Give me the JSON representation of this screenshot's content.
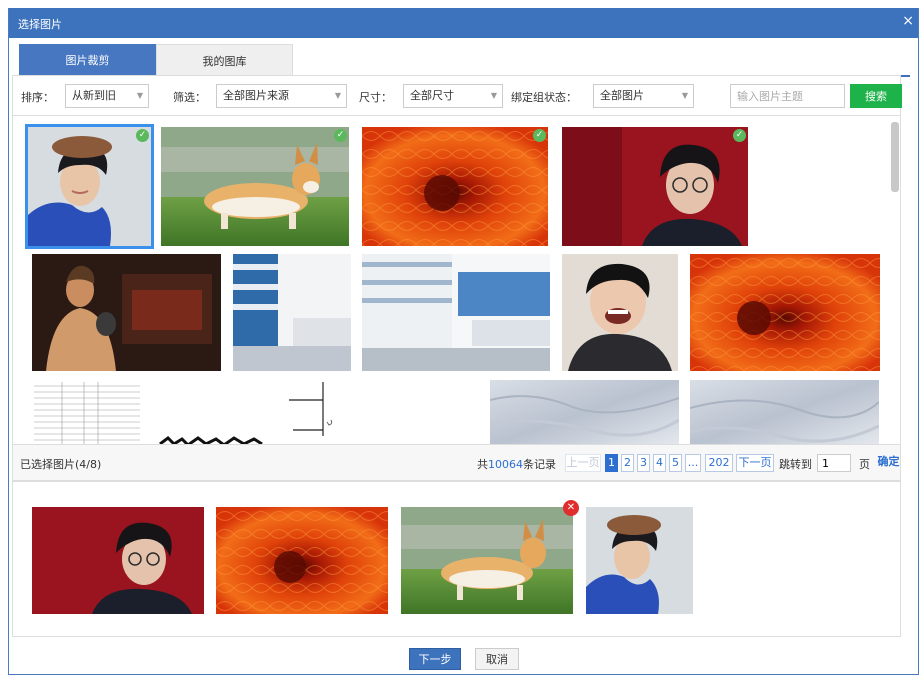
{
  "dialog": {
    "title": "选择图片",
    "close": "×"
  },
  "tabs": [
    "图片裁剪",
    "我的图库"
  ],
  "filters": {
    "sort_label": "排序：",
    "sort_value": "从新到旧",
    "filter_label": "筛选：",
    "filter_value": "全部图片来源",
    "size_label": "尺寸：",
    "size_value": "全部尺寸",
    "bind_label": "绑定组状态：",
    "bind_value": "全部图片",
    "search_placeholder": "输入图片主题",
    "search_button": "搜索"
  },
  "gallery": {
    "items": [
      {
        "subject": "young man in brown beret",
        "selected": true,
        "checked": true
      },
      {
        "subject": "corgi dog on grass",
        "selected": false,
        "checked": true
      },
      {
        "subject": "orange chrysanthemum",
        "selected": false,
        "checked": true
      },
      {
        "subject": "young man with glasses on red background",
        "selected": false,
        "checked": true
      },
      {
        "subject": "game character artwork",
        "selected": false,
        "checked": false
      },
      {
        "subject": "white building facade",
        "selected": false,
        "checked": false
      },
      {
        "subject": "white building facade wide",
        "selected": false,
        "checked": false
      },
      {
        "subject": "laughing young man",
        "selected": false,
        "checked": false
      },
      {
        "subject": "orange chrysanthemum",
        "selected": false,
        "checked": false
      },
      {
        "subject": "document table",
        "selected": false,
        "checked": false
      },
      {
        "subject": "black handwritten strokes",
        "selected": false,
        "checked": false
      },
      {
        "subject": "line drawing",
        "selected": false,
        "checked": false
      },
      {
        "subject": "marble texture",
        "selected": false,
        "checked": false
      },
      {
        "subject": "marble texture",
        "selected": false,
        "checked": false
      }
    ]
  },
  "selection": {
    "count_label": "已选择图片(4/8)"
  },
  "pagination": {
    "total_prefix": "共",
    "total_count": "10064",
    "total_suffix": "条记录",
    "prev": "上一页",
    "pages": [
      "1",
      "2",
      "3",
      "4",
      "5",
      "...",
      "202"
    ],
    "current_page": "1",
    "next": "下一页",
    "jump_label": "跳转到",
    "jump_value": "1",
    "page_unit": "页",
    "confirm": "确定"
  },
  "chosen": [
    {
      "subject": "young man with glasses on red background"
    },
    {
      "subject": "orange chrysanthemum"
    },
    {
      "subject": "corgi dog on grass",
      "removable": true
    },
    {
      "subject": "young man in brown beret"
    }
  ],
  "footer": {
    "next": "下一步",
    "cancel": "取消"
  },
  "colors": {
    "primary": "#3d72bd",
    "search": "#1db24a",
    "check": "#5cb85c",
    "remove": "#e02d2d",
    "selection_outline": "#3a90ea"
  }
}
